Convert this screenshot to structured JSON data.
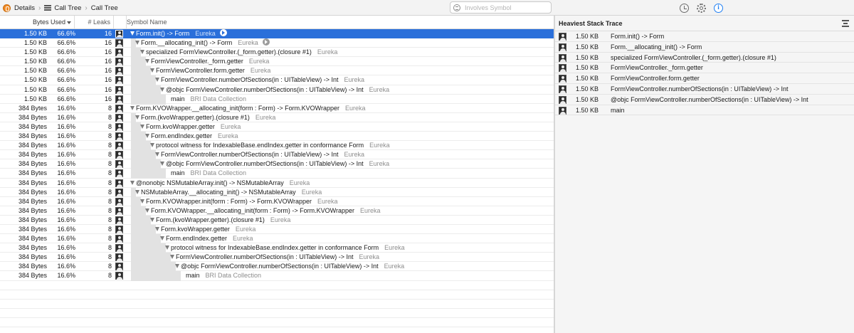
{
  "breadcrumb": {
    "items": [
      "Details",
      "Call Tree",
      "Call Tree"
    ]
  },
  "search": {
    "placeholder": "Involves Symbol",
    "value": ""
  },
  "columns": {
    "bytes": "Bytes Used",
    "leaks": "# Leaks",
    "symbol": "Symbol Name"
  },
  "inspector": {
    "icons": [
      "clock-icon",
      "gear-icon",
      "info-icon"
    ]
  },
  "rows": [
    {
      "bytes": "1.50 KB",
      "pct": "66.6%",
      "leaks": "16",
      "depth": 0,
      "expanded": true,
      "symbol": "Form.init() -> Form",
      "lib": "Eureka",
      "selected": true,
      "go": true
    },
    {
      "bytes": "1.50 KB",
      "pct": "66.6%",
      "leaks": "16",
      "depth": 1,
      "expanded": true,
      "symbol": "Form.__allocating_init() -> Form",
      "lib": "Eureka",
      "go": true
    },
    {
      "bytes": "1.50 KB",
      "pct": "66.6%",
      "leaks": "16",
      "depth": 2,
      "expanded": true,
      "symbol": "specialized FormViewController.(_form.getter).(closure #1)",
      "lib": "Eureka"
    },
    {
      "bytes": "1.50 KB",
      "pct": "66.6%",
      "leaks": "16",
      "depth": 3,
      "expanded": true,
      "symbol": "FormViewController._form.getter",
      "lib": "Eureka"
    },
    {
      "bytes": "1.50 KB",
      "pct": "66.6%",
      "leaks": "16",
      "depth": 4,
      "expanded": true,
      "symbol": "FormViewController.form.getter",
      "lib": "Eureka"
    },
    {
      "bytes": "1.50 KB",
      "pct": "66.6%",
      "leaks": "16",
      "depth": 5,
      "expanded": true,
      "symbol": "FormViewController.numberOfSections(in : UITableView) -> Int",
      "lib": "Eureka"
    },
    {
      "bytes": "1.50 KB",
      "pct": "66.6%",
      "leaks": "16",
      "depth": 6,
      "expanded": true,
      "symbol": "@objc FormViewController.numberOfSections(in : UITableView) -> Int",
      "lib": "Eureka"
    },
    {
      "bytes": "1.50 KB",
      "pct": "66.6%",
      "leaks": "16",
      "depth": 7,
      "expanded": false,
      "symbol": "main",
      "lib": "BRI Data Collection"
    },
    {
      "bytes": "384 Bytes",
      "pct": "16.6%",
      "leaks": "8",
      "depth": 0,
      "expanded": true,
      "symbol": "Form.KVOWrapper.__allocating_init(form : Form) -> Form.KVOWrapper",
      "lib": "Eureka"
    },
    {
      "bytes": "384 Bytes",
      "pct": "16.6%",
      "leaks": "8",
      "depth": 1,
      "expanded": true,
      "symbol": "Form.(kvoWrapper.getter).(closure #1)",
      "lib": "Eureka"
    },
    {
      "bytes": "384 Bytes",
      "pct": "16.6%",
      "leaks": "8",
      "depth": 2,
      "expanded": true,
      "symbol": "Form.kvoWrapper.getter",
      "lib": "Eureka"
    },
    {
      "bytes": "384 Bytes",
      "pct": "16.6%",
      "leaks": "8",
      "depth": 3,
      "expanded": true,
      "symbol": "Form.endIndex.getter",
      "lib": "Eureka"
    },
    {
      "bytes": "384 Bytes",
      "pct": "16.6%",
      "leaks": "8",
      "depth": 4,
      "expanded": true,
      "symbol": "protocol witness for IndexableBase.endIndex.getter in conformance Form",
      "lib": "Eureka"
    },
    {
      "bytes": "384 Bytes",
      "pct": "16.6%",
      "leaks": "8",
      "depth": 5,
      "expanded": true,
      "symbol": "FormViewController.numberOfSections(in : UITableView) -> Int",
      "lib": "Eureka"
    },
    {
      "bytes": "384 Bytes",
      "pct": "16.6%",
      "leaks": "8",
      "depth": 6,
      "expanded": true,
      "symbol": "@objc FormViewController.numberOfSections(in : UITableView) -> Int",
      "lib": "Eureka"
    },
    {
      "bytes": "384 Bytes",
      "pct": "16.6%",
      "leaks": "8",
      "depth": 7,
      "expanded": false,
      "symbol": "main",
      "lib": "BRI Data Collection"
    },
    {
      "bytes": "384 Bytes",
      "pct": "16.6%",
      "leaks": "8",
      "depth": 0,
      "expanded": true,
      "symbol": "@nonobjc NSMutableArray.init() -> NSMutableArray",
      "lib": "Eureka"
    },
    {
      "bytes": "384 Bytes",
      "pct": "16.6%",
      "leaks": "8",
      "depth": 1,
      "expanded": true,
      "symbol": "NSMutableArray.__allocating_init() -> NSMutableArray",
      "lib": "Eureka"
    },
    {
      "bytes": "384 Bytes",
      "pct": "16.6%",
      "leaks": "8",
      "depth": 2,
      "expanded": true,
      "symbol": "Form.KVOWrapper.init(form : Form) -> Form.KVOWrapper",
      "lib": "Eureka"
    },
    {
      "bytes": "384 Bytes",
      "pct": "16.6%",
      "leaks": "8",
      "depth": 3,
      "expanded": true,
      "symbol": "Form.KVOWrapper.__allocating_init(form : Form) -> Form.KVOWrapper",
      "lib": "Eureka"
    },
    {
      "bytes": "384 Bytes",
      "pct": "16.6%",
      "leaks": "8",
      "depth": 4,
      "expanded": true,
      "symbol": "Form.(kvoWrapper.getter).(closure #1)",
      "lib": "Eureka"
    },
    {
      "bytes": "384 Bytes",
      "pct": "16.6%",
      "leaks": "8",
      "depth": 5,
      "expanded": true,
      "symbol": "Form.kvoWrapper.getter",
      "lib": "Eureka"
    },
    {
      "bytes": "384 Bytes",
      "pct": "16.6%",
      "leaks": "8",
      "depth": 6,
      "expanded": true,
      "symbol": "Form.endIndex.getter",
      "lib": "Eureka"
    },
    {
      "bytes": "384 Bytes",
      "pct": "16.6%",
      "leaks": "8",
      "depth": 7,
      "expanded": true,
      "symbol": "protocol witness for IndexableBase.endIndex.getter in conformance Form",
      "lib": "Eureka"
    },
    {
      "bytes": "384 Bytes",
      "pct": "16.6%",
      "leaks": "8",
      "depth": 8,
      "expanded": true,
      "symbol": "FormViewController.numberOfSections(in : UITableView) -> Int",
      "lib": "Eureka"
    },
    {
      "bytes": "384 Bytes",
      "pct": "16.6%",
      "leaks": "8",
      "depth": 9,
      "expanded": true,
      "symbol": "@objc FormViewController.numberOfSections(in : UITableView) -> Int",
      "lib": "Eureka"
    },
    {
      "bytes": "384 Bytes",
      "pct": "16.6%",
      "leaks": "8",
      "depth": 10,
      "expanded": false,
      "symbol": "main",
      "lib": "BRI Data Collection"
    }
  ],
  "heaviest": {
    "title": "Heaviest Stack Trace",
    "frames": [
      {
        "bytes": "1.50 KB",
        "symbol": "Form.init() -> Form"
      },
      {
        "bytes": "1.50 KB",
        "symbol": "Form.__allocating_init() -> Form"
      },
      {
        "bytes": "1.50 KB",
        "symbol": "specialized FormViewController.(_form.getter).(closure #1)"
      },
      {
        "bytes": "1.50 KB",
        "symbol": "FormViewController._form.getter"
      },
      {
        "bytes": "1.50 KB",
        "symbol": "FormViewController.form.getter"
      },
      {
        "bytes": "1.50 KB",
        "symbol": "FormViewController.numberOfSections(in : UITableView) -> Int"
      },
      {
        "bytes": "1.50 KB",
        "symbol": "@objc FormViewController.numberOfSections(in : UITableView) -> Int"
      },
      {
        "bytes": "1.50 KB",
        "symbol": "main"
      }
    ]
  }
}
